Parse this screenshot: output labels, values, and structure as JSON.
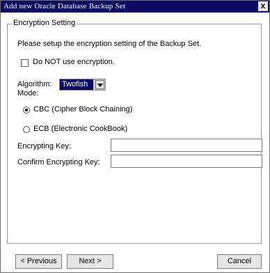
{
  "window": {
    "title": "Add new Oracle Database Backup Set",
    "close_glyph": "x"
  },
  "group": {
    "legend": "Encryption Setting",
    "instructions": "Please setup the encryption setting of the Backup Set."
  },
  "options": {
    "no_encryption_label": "Do NOT use encryption.",
    "no_encryption_checked": false
  },
  "algorithm": {
    "label": "Algorithm:",
    "selected": "Twofish"
  },
  "mode": {
    "label": "Mode:",
    "cbc_label": "CBC (Cipher Block Chaining)",
    "ecb_label": "ECB (Electronic CookBook)",
    "selected": "CBC"
  },
  "key": {
    "label": "Encrypting Key:",
    "value": "",
    "confirm_label": "Confirm Encrypting Key:",
    "confirm_value": ""
  },
  "buttons": {
    "previous": "< Previous",
    "next": "Next >",
    "cancel": "Cancel"
  },
  "colors": {
    "titlebar": "#0b0b63",
    "selection": "#0b0b63",
    "background": "#ffffff"
  }
}
